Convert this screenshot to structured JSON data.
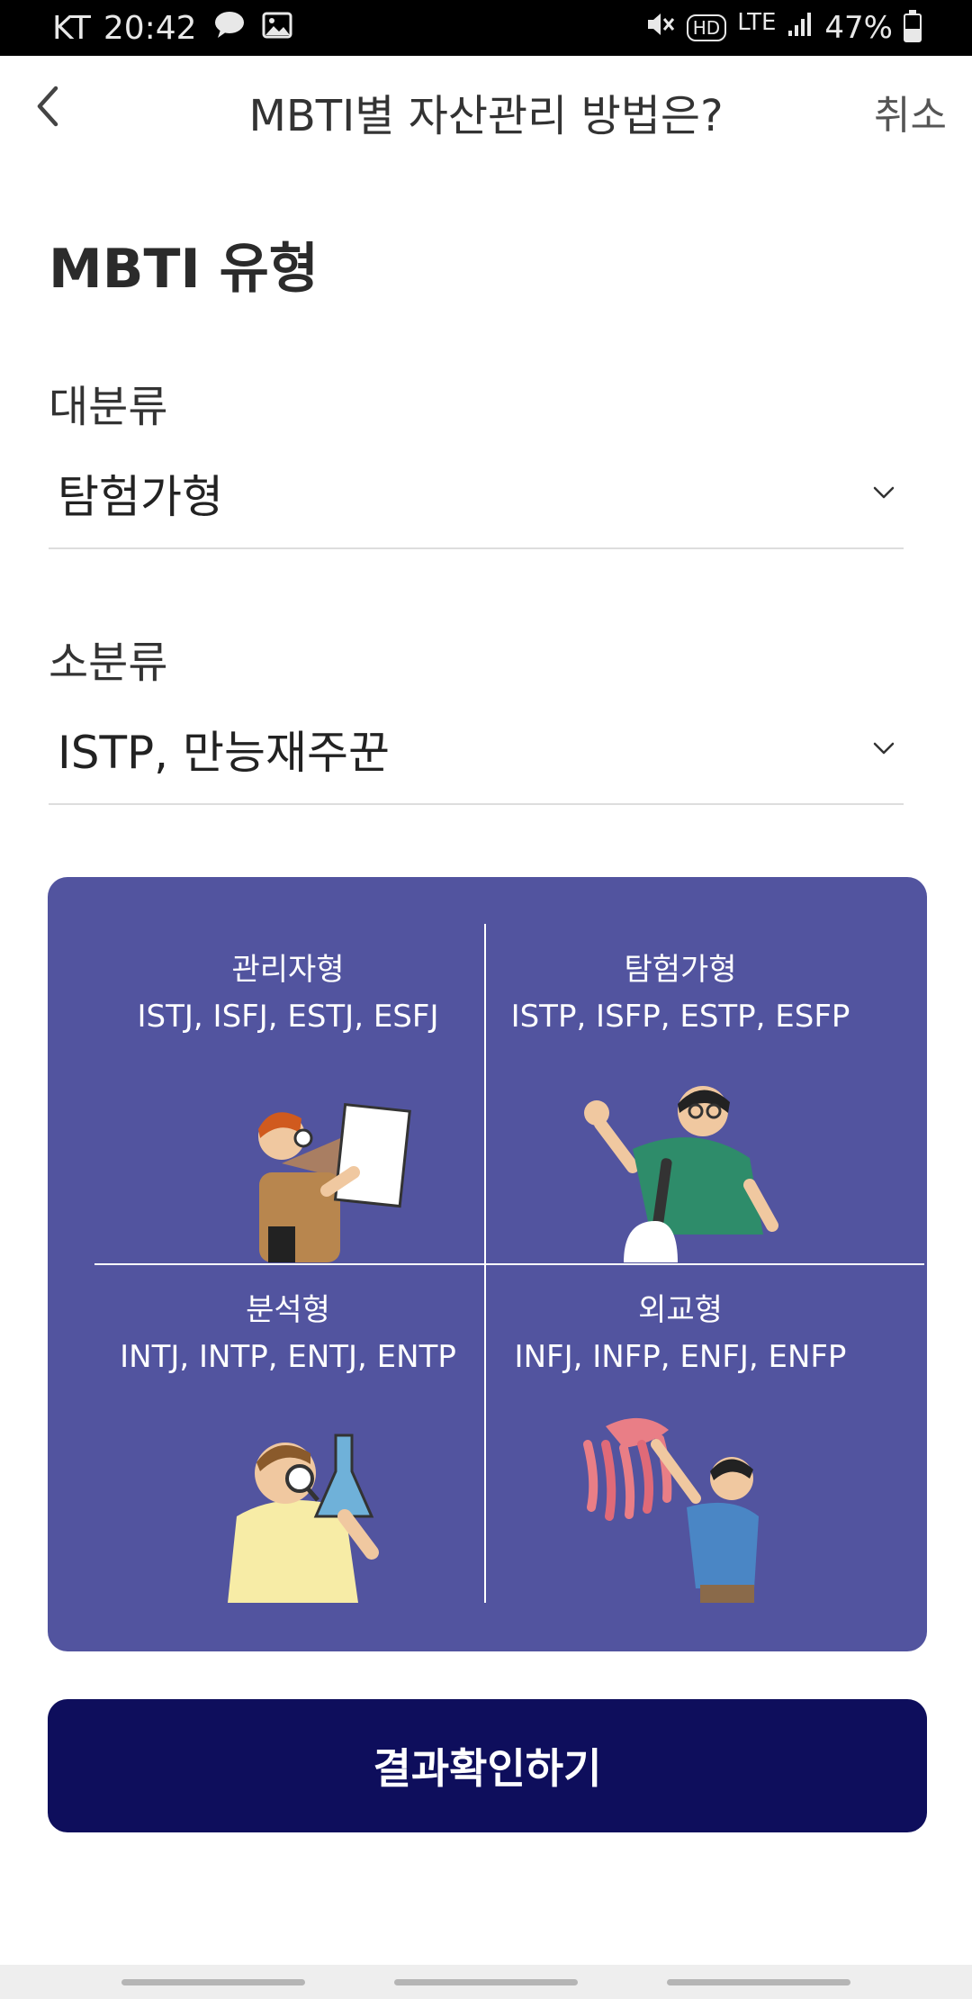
{
  "status_bar": {
    "carrier": "KT",
    "time": "20:42",
    "network": "LTE",
    "hd": "HD",
    "battery": "47%",
    "battery_level": 0.47,
    "icons": [
      "talk-bubble-icon",
      "image-icon",
      "mute-icon",
      "hd-voice-icon",
      "signal-icon",
      "battery-icon"
    ]
  },
  "header": {
    "title": "MBTI별 자산관리 방법은?",
    "cancel_label": "취소"
  },
  "form": {
    "section_title": "MBTI 유형",
    "major": {
      "label": "대분류",
      "value": "탐험가형"
    },
    "minor": {
      "label": "소분류",
      "value": "ISTP, 만능재주꾼"
    }
  },
  "types": [
    {
      "name": "관리자형",
      "members": "ISTJ, ISFJ, ESTJ, ESFJ"
    },
    {
      "name": "탐험가형",
      "members": "ISTP, ISFP, ESTP, ESFP"
    },
    {
      "name": "분석형",
      "members": "INTJ, INTP, ENTJ, ENTP"
    },
    {
      "name": "외교형",
      "members": "INFJ, INFP, ENFJ, ENFP"
    }
  ],
  "colors": {
    "card_bg": "#52549f",
    "button_bg": "#0e0e5c"
  },
  "button": {
    "label": "결과확인하기"
  }
}
